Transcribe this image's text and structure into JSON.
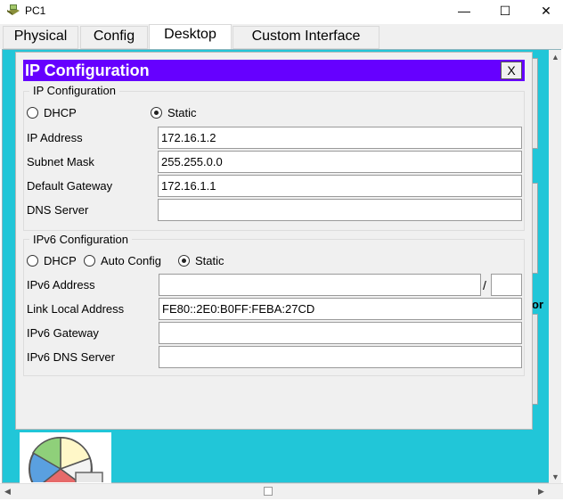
{
  "window": {
    "title": "PC1",
    "minimize_glyph": "—",
    "maximize_glyph": "☐",
    "close_glyph": "✕"
  },
  "tabs": [
    {
      "label": "Physical",
      "active": false
    },
    {
      "label": "Config",
      "active": false
    },
    {
      "label": "Desktop",
      "active": true
    },
    {
      "label": "Custom Interface",
      "active": false
    }
  ],
  "dialog": {
    "title": "IP Configuration",
    "close_label": "X",
    "ipv4": {
      "group_label": "IP Configuration",
      "dhcp_label": "DHCP",
      "static_label": "Static",
      "selected_mode": "Static",
      "ip_address_label": "IP Address",
      "ip_address_value": "172.16.1.2",
      "subnet_mask_label": "Subnet Mask",
      "subnet_mask_value": "255.255.0.0",
      "default_gateway_label": "Default Gateway",
      "default_gateway_value": "172.16.1.1",
      "dns_server_label": "DNS Server",
      "dns_server_value": ""
    },
    "ipv6": {
      "group_label": "IPv6 Configuration",
      "dhcp_label": "DHCP",
      "auto_config_label": "Auto Config",
      "static_label": "Static",
      "selected_mode": "Static",
      "address_label": "IPv6 Address",
      "address_value": "",
      "prefix_separator": "/",
      "prefix_value": "",
      "link_local_label": "Link Local Address",
      "link_local_value": "FE80::2E0:B0FF:FEBA:27CD",
      "gateway_label": "IPv6 Gateway",
      "gateway_value": "",
      "dns_server_label": "IPv6 DNS Server",
      "dns_server_value": ""
    }
  },
  "background_fragments": {
    "partial_text": "or"
  },
  "colors": {
    "desktop_bg": "#21c6d8",
    "dialog_title_bg": "#6600ff"
  },
  "icons": {
    "app_icon": "packet-tracer-pc-icon",
    "tile_icon": "pie-chart-app-icon"
  }
}
